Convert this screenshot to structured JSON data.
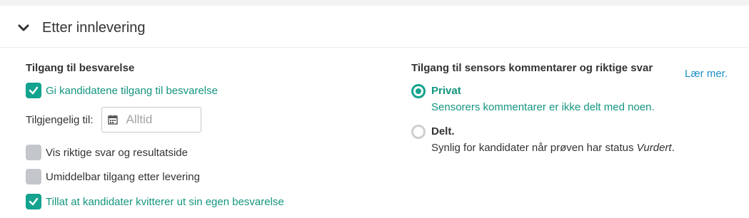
{
  "section": {
    "title": "Etter innlevering"
  },
  "left": {
    "heading": "Tilgang til besvarelse",
    "give_access": {
      "label": "Gi kandidatene tilgang til besvarelse",
      "checked": true
    },
    "available_until": {
      "label": "Tilgjengelig til:",
      "value": "Alltid"
    },
    "show_answers": {
      "label": "Vis riktige svar og resultatside",
      "checked": false
    },
    "immediate_access": {
      "label": "Umiddelbar tilgang etter levering",
      "checked": false
    },
    "allow_receipt": {
      "label": "Tillat at kandidater kvitterer ut sin egen besvarelse",
      "checked": true
    }
  },
  "right": {
    "heading": "Tilgang til sensors kommentarer og riktige svar",
    "learn_more": "Lær mer.",
    "options": [
      {
        "title": "Privat",
        "desc": "Sensorers kommentarer er ikke delt med noen.",
        "selected": true
      },
      {
        "title": "Delt.",
        "desc_prefix": "Synlig for kandidater når prøven har status ",
        "desc_emph": "Vurdert",
        "desc_suffix": ".",
        "selected": false
      }
    ]
  },
  "colors": {
    "accent": "#13a38e",
    "accent_text": "#13957f",
    "link": "#1a8fc7",
    "unchecked": "#c3c6ca"
  }
}
